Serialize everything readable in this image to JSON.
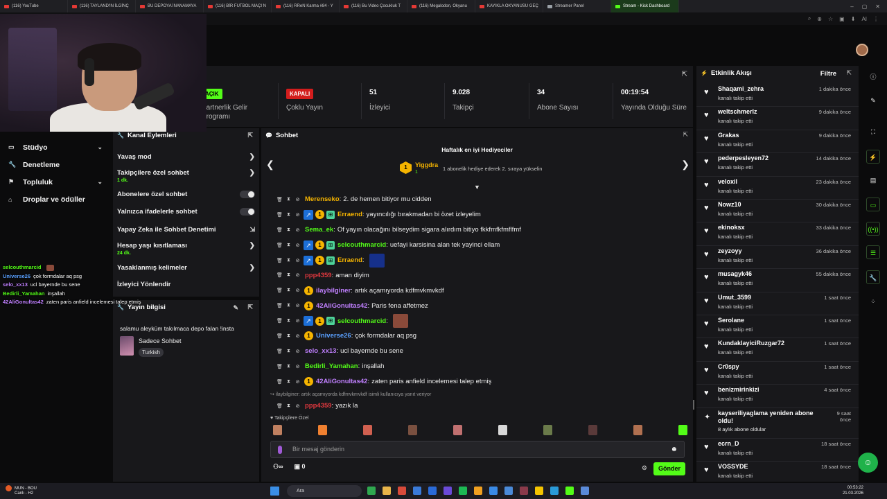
{
  "browser": {
    "tabs": [
      {
        "label": "(116) YouTube",
        "active": false
      },
      {
        "label": "(116) TAYLAND'IN İLGİNÇ",
        "active": false
      },
      {
        "label": "BU DEPOYA İNANAMAYA",
        "active": false
      },
      {
        "label": "(116) BİR FUTBOL MAÇI N",
        "active": false
      },
      {
        "label": "(116) RReN Karma #84 - Y",
        "active": false
      },
      {
        "label": "(116) Bu Video Çocukluk T",
        "active": false
      },
      {
        "label": "(116) Megalodon, Okyanu",
        "active": false
      },
      {
        "label": "KAYIKLA OKYANUSU GEÇ",
        "active": false
      },
      {
        "label": "Streamer Panel",
        "active": false
      },
      {
        "label": "Stream - Kick Dashboard",
        "active": true
      }
    ],
    "toolbar_ai_label": "AI"
  },
  "stats": [
    {
      "value_pill": "AÇIK",
      "pill_color": "#53fc18",
      "label": "Partnerlik Gelir Programı"
    },
    {
      "value_pill": "KAPALI",
      "pill_color": "#d31d1d",
      "label": "Çoklu Yayın"
    },
    {
      "value": "51",
      "label": "İzleyici"
    },
    {
      "value": "9.028",
      "label": "Takipçi"
    },
    {
      "value": "34",
      "label": "Abone Sayısı"
    },
    {
      "value": "00:19:54",
      "label": "Yayında Olduğu Süre"
    }
  ],
  "nav": {
    "items": [
      {
        "label": "Stüdyo",
        "icon": "studio-icon",
        "has_chevron": true
      },
      {
        "label": "Denetleme",
        "icon": "wrench-icon",
        "has_chevron": false
      },
      {
        "label": "Topluluk",
        "icon": "community-icon",
        "has_chevron": true
      },
      {
        "label": "Droplar ve ödüller",
        "icon": "gift-icon",
        "has_chevron": false
      }
    ]
  },
  "overlay_chat": [
    {
      "user": "selcouthmarcid",
      "color": "#53fc18",
      "text": ""
    },
    {
      "user": "Universe26",
      "color": "#5aa0ff",
      "text": "çok formdalar aq psg"
    },
    {
      "user": "selo_xx13",
      "color": "#c080ff",
      "text": "ucl bayernde bu sene"
    },
    {
      "user": "Bedirli_Yamahan",
      "color": "#53fc18",
      "text": "inşallah"
    },
    {
      "user": "42AliGonultas42",
      "color": "#c080ff",
      "text": "zaten paris anfield incelemesi talep etmiş"
    }
  ],
  "actions": {
    "title": "Kanal Eylemleri",
    "rows": [
      {
        "label": "Yavaş mod",
        "sub": "",
        "control": "chevron"
      },
      {
        "label": "Takipçilere özel sohbet",
        "sub": "1 dk.",
        "control": "chevron"
      },
      {
        "label": "Abonelere özel sohbet",
        "sub": "",
        "control": "toggle"
      },
      {
        "label": "Yalnızca ifadelerle sohbet",
        "sub": "",
        "control": "toggle"
      },
      {
        "label": "Yapay Zeka ile Sohbet Denetimi",
        "sub": "",
        "control": "external"
      },
      {
        "label": "Hesap yaşı kısıtlaması",
        "sub": "24 dk.",
        "control": "chevron"
      },
      {
        "label": "Yasaklanmış kelimeler",
        "sub": "",
        "control": "chevron"
      },
      {
        "label": "İzleyici Yönlendir",
        "sub": "",
        "control": "none"
      }
    ]
  },
  "stream_info": {
    "title": "Yayın bilgisi",
    "stream_title": "salamu aleyküm takılmaca depo falan !insta",
    "category": "Sadece Sohbet",
    "language": "Turkish"
  },
  "chat": {
    "title": "Sohbet",
    "gifters_title": "Haftalık en iyi Hediyeciler",
    "top_gifter": {
      "rank": "1",
      "name": "Yiggdra",
      "count": "1"
    },
    "gift_hint": "1 abonelik hediye ederek 2. sıraya yükselin",
    "messages": [
      {
        "user": "Merenseko",
        "color": "#f5b400",
        "text": "2. de hemen bitiyor mu cidden",
        "vip": false,
        "sub": false,
        "gift": false,
        "emote": ""
      },
      {
        "user": "Erraend",
        "color": "#f5b400",
        "text": "yayıncılığı bırakmadan bi özet izleyelim",
        "vip": true,
        "sub": true,
        "gift": true,
        "emote": ""
      },
      {
        "user": "Sema_ek",
        "color": "#53fc18",
        "text": "Of yayın olacağını bilseydim sigara alırdım bitiyo fkkfmfkfmflfmf",
        "vip": false,
        "sub": false,
        "gift": false,
        "emote": ""
      },
      {
        "user": "selcouthmarcid",
        "color": "#53fc18",
        "text": "uefayi karsisina alan tek yayinci ellam",
        "vip": true,
        "sub": true,
        "gift": true,
        "emote": ""
      },
      {
        "user": "Erraend",
        "color": "#f5b400",
        "text": "",
        "vip": true,
        "sub": true,
        "gift": true,
        "emote": "#16308a"
      },
      {
        "user": "ppp4359",
        "color": "#e0383e",
        "text": "aman diyim",
        "vip": false,
        "sub": false,
        "gift": false,
        "emote": ""
      },
      {
        "user": "ilaybilginer",
        "color": "#c080ff",
        "text": "artık açamıyorda kdfmvkmvkdf",
        "vip": false,
        "sub": true,
        "gift": false,
        "emote": ""
      },
      {
        "user": "42AliGonultas42",
        "color": "#c080ff",
        "text": "Paris fena affetmez",
        "vip": false,
        "sub": true,
        "gift": false,
        "emote": ""
      },
      {
        "user": "selcouthmarcid",
        "color": "#53fc18",
        "text": "",
        "vip": true,
        "sub": true,
        "gift": true,
        "emote": "#8a4a3a"
      },
      {
        "user": "Universe26",
        "color": "#5aa0ff",
        "text": "çok formdalar aq psg",
        "vip": false,
        "sub": true,
        "gift": false,
        "emote": ""
      },
      {
        "user": "selo_xx13",
        "color": "#c080ff",
        "text": "ucl bayernde bu sene",
        "vip": false,
        "sub": false,
        "gift": false,
        "emote": ""
      },
      {
        "user": "Bedirli_Yamahan",
        "color": "#53fc18",
        "text": "inşallah",
        "vip": false,
        "sub": false,
        "gift": false,
        "emote": ""
      },
      {
        "user": "42AliGonultas42",
        "color": "#c080ff",
        "text": "zaten paris anfield incelemesi talep etmiş",
        "vip": false,
        "sub": true,
        "gift": false,
        "emote": ""
      }
    ],
    "reply_hint": "ilaybilginer: artık açamıyorda kdfmvkmvkdf isimli kullanıcıya yanıt veriyor",
    "last_message": {
      "user": "ppp4359",
      "color": "#e0383e",
      "text": "yazık la"
    },
    "followers_only_label": "Takipçilere Özel",
    "input_placeholder": "Bir mesaj gönderin",
    "viewer_count_label": "0",
    "send_label": "Gönder"
  },
  "activity": {
    "title": "Etkinlik Akışı",
    "filter_label": "Filtre",
    "events": [
      {
        "user": "Shaqami_zehra",
        "text": "kanalı takip etti",
        "time": "1 dakika önce",
        "icon": "heart"
      },
      {
        "user": "weltschmerlz",
        "text": "kanalı takip etti",
        "time": "9 dakika önce",
        "icon": "heart"
      },
      {
        "user": "Grakas",
        "text": "kanalı takip etti",
        "time": "9 dakika önce",
        "icon": "heart"
      },
      {
        "user": "pederpesleyen72",
        "text": "kanalı takip etti",
        "time": "14 dakika önce",
        "icon": "heart"
      },
      {
        "user": "veloxil",
        "text": "kanalı takip etti",
        "time": "23 dakika önce",
        "icon": "heart"
      },
      {
        "user": "Nowz10",
        "text": "kanalı takip etti",
        "time": "30 dakika önce",
        "icon": "heart"
      },
      {
        "user": "ekinoksx",
        "text": "kanalı takip etti",
        "time": "33 dakika önce",
        "icon": "heart"
      },
      {
        "user": "zeyzoyy",
        "text": "kanalı takip etti",
        "time": "36 dakika önce",
        "icon": "heart"
      },
      {
        "user": "musagyk46",
        "text": "kanalı takip etti",
        "time": "55 dakika önce",
        "icon": "heart"
      },
      {
        "user": "Umut_3599",
        "text": "kanalı takip etti",
        "time": "1 saat önce",
        "icon": "heart"
      },
      {
        "user": "Serolane",
        "text": "kanalı takip etti",
        "time": "1 saat önce",
        "icon": "heart"
      },
      {
        "user": "KundaklayiciRuzgar72",
        "text": "kanalı takip etti",
        "time": "1 saat önce",
        "icon": "heart"
      },
      {
        "user": "Cr0spy",
        "text": "kanalı takip etti",
        "time": "1 saat önce",
        "icon": "heart"
      },
      {
        "user": "benizmirinkizi",
        "text": "kanalı takip etti",
        "time": "4 saat önce",
        "icon": "heart"
      },
      {
        "user": "kayseriliyaglama yeniden abone oldu!",
        "text": "8 aylık abone oldular",
        "time": "9 saat önce",
        "icon": "star"
      },
      {
        "user": "ecrn_D",
        "text": "kanalı takip etti",
        "time": "18 saat önce",
        "icon": "heart"
      },
      {
        "user": "VOSSYDE",
        "text": "kanalı takip etti",
        "time": "18 saat önce",
        "icon": "heart"
      }
    ]
  },
  "taskbar": {
    "weather_title": "MUN - BOU",
    "weather_sub": "Canlı - H2",
    "search_label": "Ara",
    "time": "00:53:22",
    "date": "21.03.2026"
  }
}
